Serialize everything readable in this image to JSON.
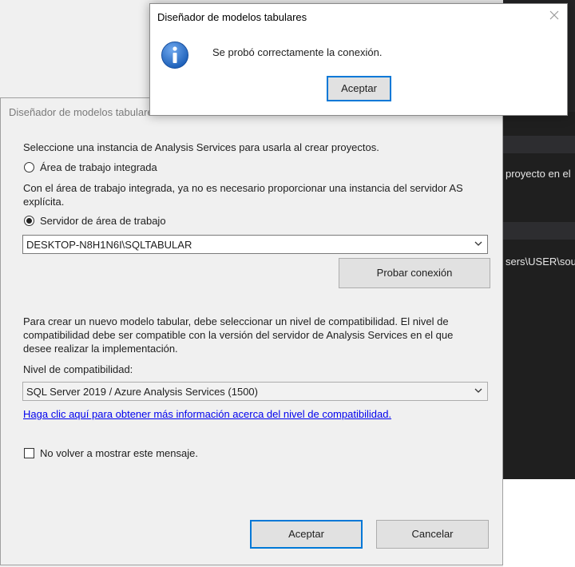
{
  "background": {
    "lines": [
      {
        "text": "proyecto en el"
      },
      {
        "text": "sers\\USER\\sour"
      }
    ]
  },
  "main_dialog": {
    "title": "Diseñador de modelos tabulares",
    "instance_prompt": "Seleccione una instancia de Analysis Services para usarla al crear proyectos.",
    "radio_integrated_label": "Área de trabajo integrada",
    "radio_integrated_checked": false,
    "integrated_note_line1": "Con el área de trabajo integrada, ya no es necesario proporcionar una instancia del servidor AS",
    "integrated_note_line2": "explícita.",
    "radio_server_label": "Servidor de área de trabajo",
    "radio_server_checked": true,
    "server_value": "DESKTOP-N8H1N6I\\SQLTABULAR",
    "test_connection_label": "Probar conexión",
    "compat_note_line1": "Para crear un nuevo modelo tabular, debe seleccionar un nivel de compatibilidad. El nivel de",
    "compat_note_line2": "compatibilidad debe ser compatible con la versión del servidor de Analysis Services en el que",
    "compat_note_line3": "desee realizar la implementación.",
    "compat_level_label": "Nivel de compatibilidad:",
    "compat_level_value": "SQL Server 2019 / Azure Analysis Services (1500)",
    "compat_link": "Haga clic aquí para obtener más información acerca del nivel de compatibilidad.",
    "dont_show_label": "No volver a mostrar este mensaje.",
    "dont_show_checked": false,
    "ok_label": "Aceptar",
    "cancel_label": "Cancelar"
  },
  "message_box": {
    "title": "Diseñador de modelos tabulares",
    "message": "Se probó correctamente la conexión.",
    "ok_label": "Aceptar",
    "icon": "info-icon"
  },
  "colors": {
    "accent": "#0078d7",
    "link": "#0000ee",
    "info_icon": "#1c5fb8"
  }
}
